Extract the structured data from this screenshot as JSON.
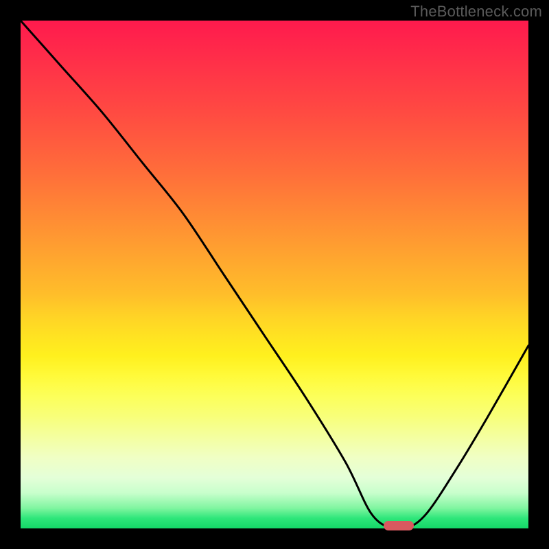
{
  "watermark": "TheBottleneck.com",
  "colors": {
    "black": "#000000",
    "curve": "#000000",
    "marker": "#d9595f",
    "watermark_text": "#5a5a5a"
  },
  "chart_data": {
    "type": "line",
    "title": "",
    "xlabel": "",
    "ylabel": "",
    "xlim": [
      0,
      100
    ],
    "ylim": [
      0,
      100
    ],
    "grid": false,
    "legend": false,
    "series": [
      {
        "name": "bottleneck-curve",
        "x": [
          0,
          8,
          16,
          24,
          32,
          40,
          48,
          56,
          64,
          69,
          73,
          76,
          80,
          86,
          92,
          100
        ],
        "y": [
          100,
          91,
          82,
          72,
          62,
          50,
          38,
          26,
          13,
          3,
          0,
          0,
          3,
          12,
          22,
          36
        ]
      }
    ],
    "gradient_description": "red-top to green-bottom (bottleneck severity)",
    "marker": {
      "x": 74.5,
      "y": 0,
      "shape": "rounded-rect"
    }
  }
}
